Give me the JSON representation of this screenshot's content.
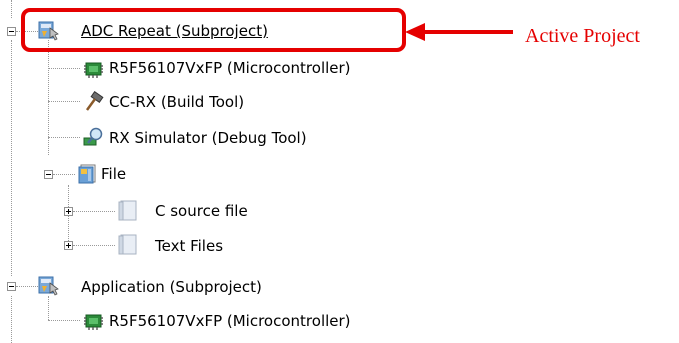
{
  "tree": {
    "items": [
      {
        "label": "ADC Repeat (Subproject)",
        "icon": "subproject-icon",
        "expanded": true,
        "active": true
      },
      {
        "label": "R5F56107VxFP (Microcontroller)",
        "icon": "chip-icon"
      },
      {
        "label": "CC-RX (Build Tool)",
        "icon": "hammer-icon"
      },
      {
        "label": "RX Simulator (Debug Tool)",
        "icon": "magnifier-icon"
      },
      {
        "label": "File",
        "icon": "folder-icon",
        "expanded": true
      },
      {
        "label": "C source file",
        "icon": "folder-category-icon",
        "expanded": false
      },
      {
        "label": "Text Files",
        "icon": "folder-category-icon",
        "expanded": false
      },
      {
        "label": "Application (Subproject)",
        "icon": "subproject-icon",
        "expanded": true
      },
      {
        "label": "R5F56107VxFP (Microcontroller)",
        "icon": "chip-icon"
      }
    ]
  },
  "callout": {
    "label": "Active Project",
    "color": "#e50000"
  }
}
